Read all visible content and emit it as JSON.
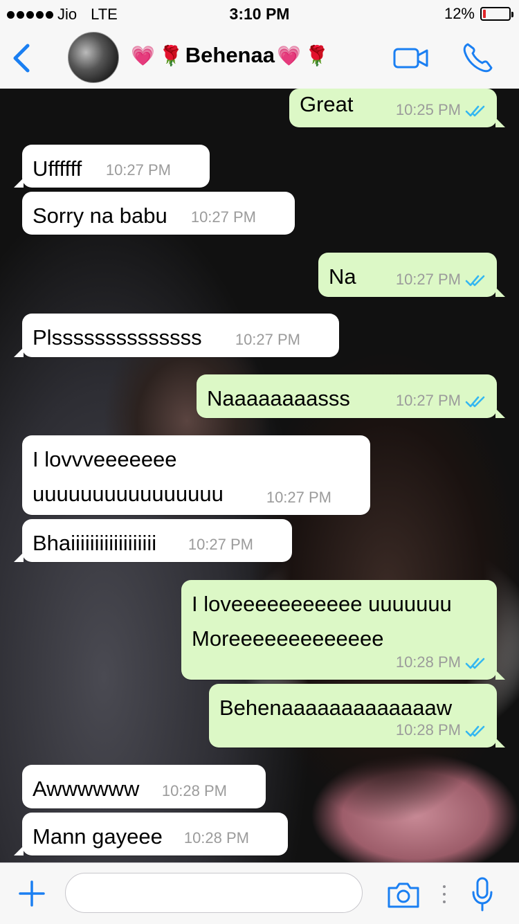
{
  "status_bar": {
    "carrier": "Jio",
    "network": "LTE",
    "time": "3:10 PM",
    "battery": "12%",
    "battery_level": 0.12
  },
  "header": {
    "contact_name": "Behenaa",
    "back_icon": "chevron-left-icon",
    "video_icon": "video-camera-icon",
    "call_icon": "phone-icon",
    "emoji_heart": "💗",
    "emoji_rose": "🌹"
  },
  "messages": [
    {
      "dir": "out",
      "text": "Great",
      "time": "10:25 PM"
    },
    {
      "dir": "in",
      "text": "Uffffff",
      "time": "10:27 PM"
    },
    {
      "dir": "in",
      "text": "Sorry na babu",
      "time": "10:27 PM"
    },
    {
      "dir": "out",
      "text": "Na",
      "time": "10:27 PM"
    },
    {
      "dir": "in",
      "text": "Plssssssssssssss",
      "time": "10:27 PM"
    },
    {
      "dir": "out",
      "text": "Naaaaaaaasss",
      "time": "10:27 PM"
    },
    {
      "dir": "in",
      "text": "I lovvveeeeeee\nuuuuuuuuuuuuuuuu",
      "time": "10:27 PM"
    },
    {
      "dir": "in",
      "text": "Bhaiiiiiiiiiiiiiiiiii",
      "time": "10:27 PM"
    },
    {
      "dir": "out",
      "text": "I loveeeeeeeeeee uuuuuuu\nMoreeeeeeeeeeeee",
      "time": "10:28 PM"
    },
    {
      "dir": "out",
      "text": "Behenaaaaaaaaaaaaaw",
      "time": "10:28 PM"
    },
    {
      "dir": "in",
      "text": "Awwwwww",
      "time": "10:28 PM"
    },
    {
      "dir": "in",
      "text": "Mann gayeee",
      "time": "10:28 PM"
    }
  ],
  "input": {
    "placeholder": "",
    "plus_icon": "plus-icon",
    "camera_icon": "camera-icon",
    "mic_icon": "microphone-icon",
    "scroll_icon": "chevron-down-circle-icon"
  },
  "colors": {
    "accent": "#1a7ff2",
    "outgoing_bubble": "#dcf8c6",
    "incoming_bubble": "#ffffff",
    "read_ticks": "#34b7f1"
  }
}
